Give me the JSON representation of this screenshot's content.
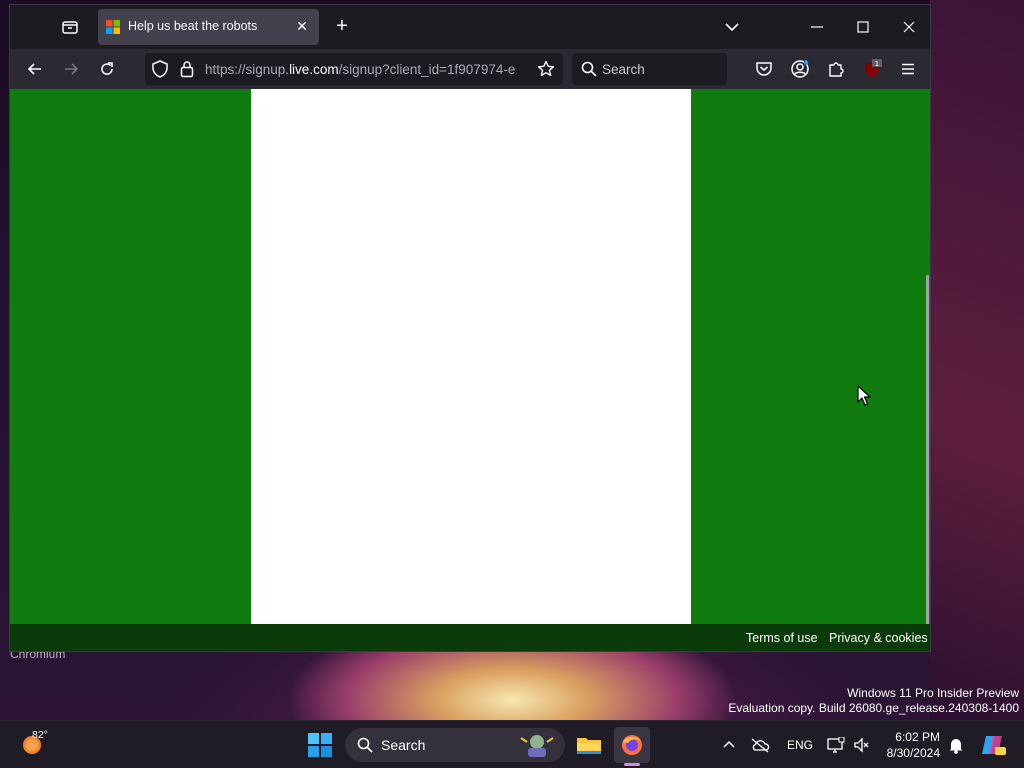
{
  "browser": {
    "tab": {
      "title": "Help us beat the robots"
    },
    "url": {
      "prefix": "https://signup.",
      "host": "live.com",
      "rest": "/signup?client_id=1f907974-e"
    },
    "search_placeholder": "Search"
  },
  "page": {
    "footer": {
      "terms": "Terms of use",
      "privacy": "Privacy & cookies"
    }
  },
  "desktop": {
    "label": "Chromium",
    "watermark": {
      "line1": "Windows 11 Pro Insider Preview",
      "line2": "Evaluation copy. Build 26080.ge_release.240308-1400"
    }
  },
  "taskbar": {
    "weather_temp": "82°",
    "search_label": "Search",
    "language": "ENG",
    "time": "6:02 PM",
    "date": "8/30/2024",
    "extension_badge": "1"
  },
  "colors": {
    "page_background": "#107c10",
    "footer_background": "#0b3a0b",
    "card": "#ffffff"
  }
}
